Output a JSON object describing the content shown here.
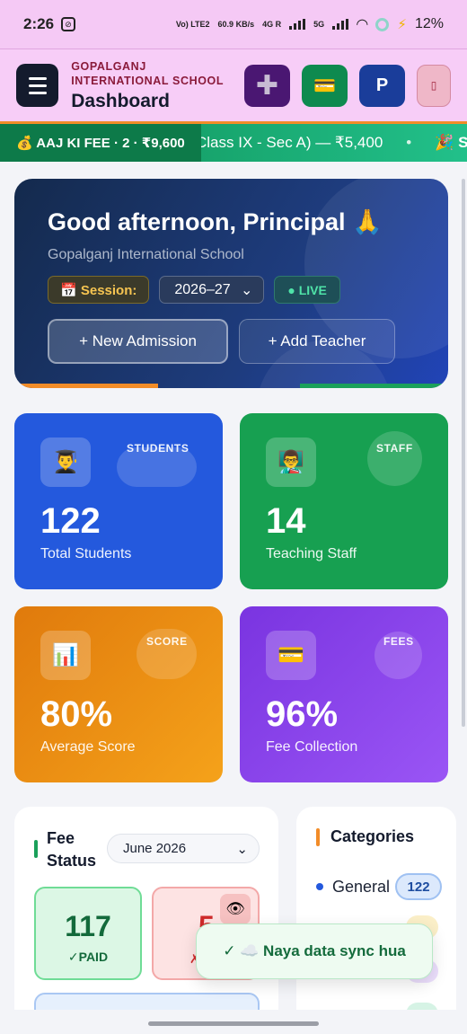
{
  "status_bar": {
    "time": "2:26",
    "volte": "Vo) LTE2",
    "speed": "60.9 KB/s",
    "net1": "4G R",
    "net2": "5G",
    "battery": "12%"
  },
  "header": {
    "school_name": "GOPALGANJ INTERNATIONAL SCHOOL",
    "page_title": "Dashboard",
    "buttons": {
      "add": "✚",
      "fees": "💳",
      "profile": "P",
      "extra": "▯"
    }
  },
  "ticker": {
    "badge": "💰 AAJ KI FEE · 2 · ₹9,600",
    "items": [
      "Class IX - Sec A) — ₹5,400",
      "•",
      "🎉 Shal"
    ]
  },
  "hero": {
    "greeting": "Good afternoon, Principal 🙏",
    "school": "Gopalganj International School",
    "session_label": "📅 Session:",
    "session_value": "2026–27",
    "live_label": "● LIVE",
    "new_admission": "+ New Admission",
    "add_teacher": "+ Add Teacher"
  },
  "stats": [
    {
      "icon": "👨‍🎓",
      "tag": "STUDENTS",
      "value": "122",
      "label": "Total Students"
    },
    {
      "icon": "👨‍🏫",
      "tag": "STAFF",
      "value": "14",
      "label": "Teaching Staff"
    },
    {
      "icon": "📊",
      "tag": "SCORE",
      "value": "80%",
      "label": "Average Score"
    },
    {
      "icon": "💳",
      "tag": "FEES",
      "value": "96%",
      "label": "Fee Collection"
    }
  ],
  "fee_status": {
    "title": "Fee Status",
    "month": "June 2026",
    "paid_count": "117",
    "paid_label": "✓PAID",
    "unpaid_count": "5",
    "unpaid_label": "✗",
    "eye": "👁"
  },
  "categories": {
    "title": "Categories",
    "items": [
      {
        "name": "General",
        "count": "122"
      }
    ]
  },
  "toast": {
    "text": "✓ ☁️ Naya data sync hua"
  },
  "colors": {
    "header_bg": "#f7cdf7",
    "students": "#2459dd",
    "staff": "#17a051",
    "score": "#f5a21a",
    "fees": "#8c47ef",
    "hero": "#1e3c7e"
  }
}
